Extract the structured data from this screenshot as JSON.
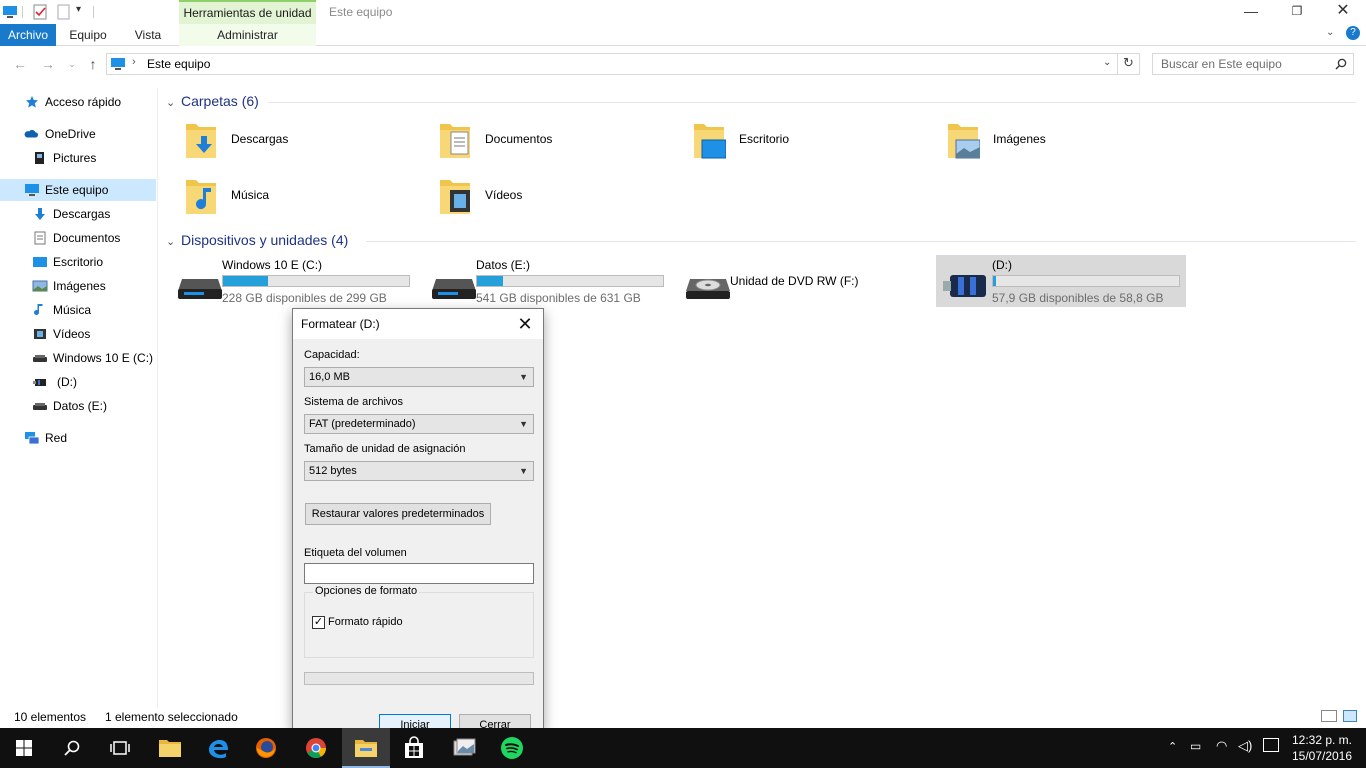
{
  "window": {
    "context_tab_header": "Herramientas de unidad",
    "title": "Este equipo",
    "tabs": [
      "Archivo",
      "Equipo",
      "Vista"
    ],
    "context_tab": "Administrar"
  },
  "address": {
    "path": "Este equipo",
    "search_placeholder": "Buscar en Este equipo"
  },
  "sidebar": {
    "items": [
      {
        "label": "Acceso rápido",
        "icon": "star-icon"
      },
      {
        "label": "OneDrive",
        "icon": "cloud-icon"
      },
      {
        "label": "Pictures",
        "icon": "picture-folder-icon"
      },
      {
        "label": "Este equipo",
        "icon": "computer-icon"
      },
      {
        "label": "Descargas",
        "icon": "download-arrow-icon"
      },
      {
        "label": "Documentos",
        "icon": "document-icon"
      },
      {
        "label": "Escritorio",
        "icon": "desktop-icon"
      },
      {
        "label": "Imágenes",
        "icon": "image-icon"
      },
      {
        "label": "Música",
        "icon": "music-note-icon"
      },
      {
        "label": "Vídeos",
        "icon": "video-icon"
      },
      {
        "label": "Windows 10 E (C:)",
        "icon": "drive-icon"
      },
      {
        "label": "(D:)",
        "icon": "usb-drive-icon"
      },
      {
        "label": "Datos (E:)",
        "icon": "drive-icon"
      },
      {
        "label": "Red",
        "icon": "network-icon"
      }
    ]
  },
  "folders": {
    "header": "Carpetas (6)",
    "items": [
      {
        "label": "Descargas",
        "icon": "downloads-folder-icon"
      },
      {
        "label": "Documentos",
        "icon": "documents-folder-icon"
      },
      {
        "label": "Escritorio",
        "icon": "desktop-folder-icon"
      },
      {
        "label": "Imágenes",
        "icon": "pictures-folder-icon"
      },
      {
        "label": "Música",
        "icon": "music-folder-icon"
      },
      {
        "label": "Vídeos",
        "icon": "videos-folder-icon"
      }
    ]
  },
  "devices": {
    "header": "Dispositivos y unidades (4)",
    "items": [
      {
        "name": "Windows 10 E (C:)",
        "free": "228 GB disponibles de 299 GB",
        "used_fraction": 0.24
      },
      {
        "name": "Datos (E:)",
        "free": "541 GB disponibles de 631 GB",
        "used_fraction": 0.14
      },
      {
        "name": "Unidad de DVD RW (F:)",
        "free": "",
        "used_fraction": null
      },
      {
        "name": "(D:)",
        "free": "57,9 GB disponibles de 58,8 GB",
        "used_fraction": 0.015
      }
    ]
  },
  "status": {
    "count": "10 elementos",
    "selection": "1 elemento seleccionado"
  },
  "dialog": {
    "title": "Formatear  (D:)",
    "capacity_label": "Capacidad:",
    "capacity_value": "16,0 MB",
    "fs_label": "Sistema de archivos",
    "fs_value": "FAT (predeterminado)",
    "alloc_label": "Tamaño de unidad de asignación",
    "alloc_value": "512 bytes",
    "restore_button": "Restaurar valores predeterminados",
    "volume_label": "Etiqueta del volumen",
    "volume_value": "",
    "options_title": "Opciones de formato",
    "quick_format_label": "Formato rápido",
    "quick_format_checked": "✓",
    "start_button": "Iniciar",
    "close_button": "Cerrar"
  },
  "taskbar": {
    "time": "12:32 p. m.",
    "date": "15/07/2016"
  },
  "colors": {
    "accent": "#1979ca",
    "progress_fill": "#26a0da",
    "selection": "#cce8ff",
    "taskbar": "#101010"
  }
}
